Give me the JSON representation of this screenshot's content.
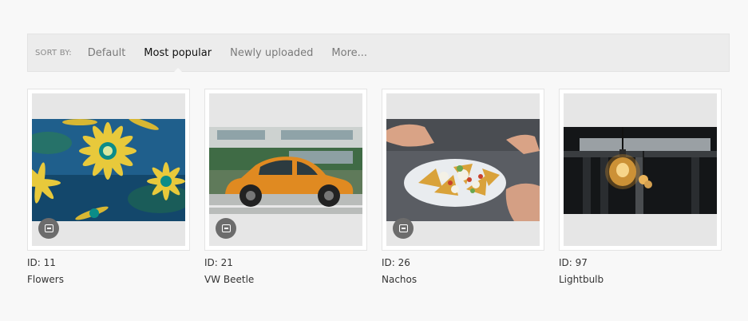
{
  "sort": {
    "label": "SORT BY:",
    "options": [
      {
        "label": "Default",
        "active": false
      },
      {
        "label": "Most popular",
        "active": true
      },
      {
        "label": "Newly uploaded",
        "active": false
      },
      {
        "label": "More...",
        "active": false
      }
    ]
  },
  "cards": [
    {
      "id_text": "ID: 11",
      "name": "Flowers",
      "has_badge": true,
      "badge_icon": "message-icon"
    },
    {
      "id_text": "ID: 21",
      "name": "VW Beetle",
      "has_badge": true,
      "badge_icon": "message-icon"
    },
    {
      "id_text": "ID: 26",
      "name": "Nachos",
      "has_badge": true,
      "badge_icon": "message-icon"
    },
    {
      "id_text": "ID: 97",
      "name": "Lightbulb",
      "has_badge": false
    }
  ],
  "colors": {
    "page_bg": "#f8f8f8",
    "sortbar_bg": "#ececec",
    "card_well_bg": "#e6e6e6",
    "active_text": "#111111",
    "inactive_text": "#7a7a7a",
    "badge_bg": "#6c6c6c"
  }
}
